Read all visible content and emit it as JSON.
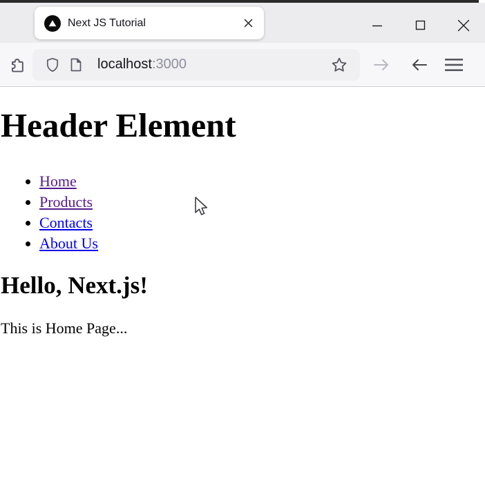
{
  "browser": {
    "tab": {
      "title": "Next JS Tutorial",
      "favicon_icon": "nextjs-triangle-icon",
      "close_icon": "close-icon"
    },
    "window_controls": {
      "minimize_icon": "minimize-icon",
      "maximize_icon": "maximize-icon",
      "close_icon": "close-icon"
    },
    "toolbar": {
      "extensions_icon": "puzzle-icon",
      "shield_icon": "shield-icon",
      "page_info_icon": "page-icon",
      "bookmark_icon": "star-icon",
      "forward_icon": "arrow-forward-icon",
      "back_icon": "arrow-back-icon",
      "menu_icon": "hamburger-menu-icon",
      "url_host": "localhost",
      "url_port": ":3000"
    },
    "colors": {
      "tab_strip_bg": "#ececef",
      "toolbar_bg": "#f7f7f9",
      "urlbar_bg": "#f0f0f3",
      "icon_color": "#5b5b66",
      "disabled_icon_color": "#b9b9c1"
    }
  },
  "page": {
    "heading": "Header Element",
    "nav_links": [
      {
        "label": "Home",
        "visited": true
      },
      {
        "label": "Products",
        "visited": true
      },
      {
        "label": "Contacts",
        "visited": false
      },
      {
        "label": "About Us",
        "visited": false
      }
    ],
    "subheading": "Hello, Next.js!",
    "body_text": "This is Home Page...",
    "colors": {
      "link_unvisited": "#0000EE",
      "link_visited": "#551A8B",
      "text": "#000000"
    }
  }
}
